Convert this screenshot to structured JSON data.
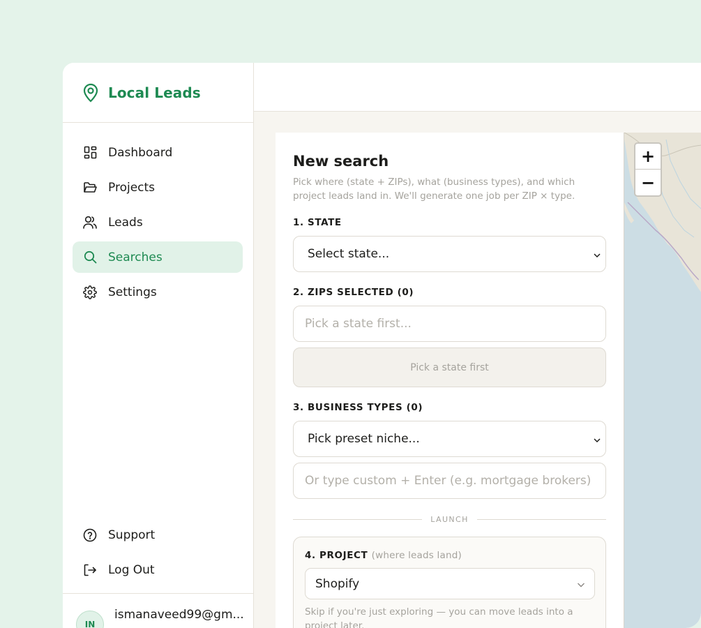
{
  "app": {
    "name": "Local Leads"
  },
  "sidebar": {
    "items": [
      {
        "label": "Dashboard",
        "icon": "dashboard-grid-icon"
      },
      {
        "label": "Projects",
        "icon": "folder-icon"
      },
      {
        "label": "Leads",
        "icon": "users-icon"
      },
      {
        "label": "Searches",
        "icon": "search-icon",
        "active": true
      },
      {
        "label": "Settings",
        "icon": "gear-icon"
      }
    ],
    "bottom": [
      {
        "label": "Support",
        "icon": "help-circle-icon"
      },
      {
        "label": "Log Out",
        "icon": "logout-icon"
      }
    ],
    "user": {
      "initials": "IN",
      "email": "ismanaveed99@gm..."
    }
  },
  "search": {
    "title": "New search",
    "subtitle": "Pick where (state + ZIPs), what (business types), and which project leads land in. We'll generate one job per ZIP × type.",
    "state_label": "1. STATE",
    "state_value": "Select state...",
    "zips_label": "2. ZIPS SELECTED (0)",
    "zips_placeholder": "Pick a state first...",
    "zips_button": "Pick a state first",
    "types_label": "3. BUSINESS TYPES (0)",
    "types_select": "Pick preset niche...",
    "types_custom_placeholder": "Or type custom + Enter (e.g. mortgage brokers)",
    "launch_divider": "LAUNCH",
    "project_label": "4. PROJECT",
    "project_label_note": "(where leads land)",
    "project_value": "Shopify",
    "project_hint": "Skip if you're just exploring — you can move leads into a project later."
  },
  "map": {
    "zoom_in": "+",
    "zoom_out": "−"
  },
  "colors": {
    "accent": "#1e8a52",
    "accent_bg": "#e1f2e8",
    "page_bg": "#e4f3ea"
  }
}
